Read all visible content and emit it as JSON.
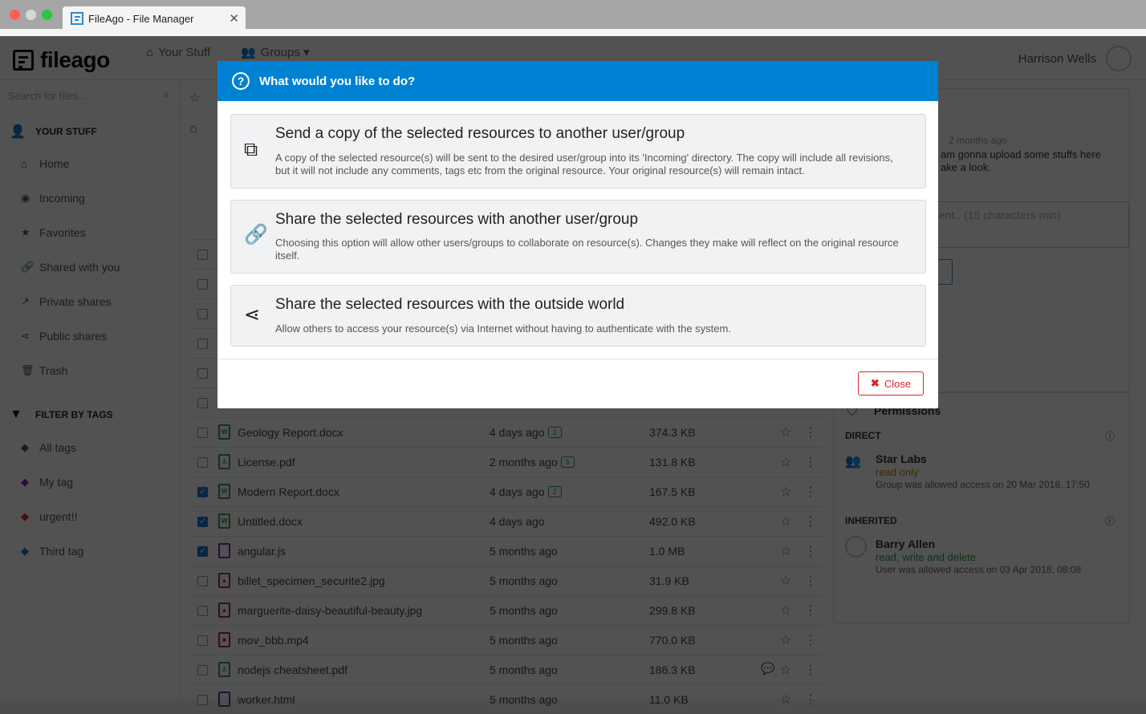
{
  "browser": {
    "tab_title": "FileAgo - File Manager"
  },
  "header": {
    "logo": "fileago",
    "nav_your_stuff": "Your Stuff",
    "nav_groups": "Groups",
    "user_name": "Harrison Wells"
  },
  "sidebar": {
    "search_placeholder": "Search for files...",
    "your_stuff": "YOUR STUFF",
    "items": [
      {
        "label": "Home",
        "icon": "home-icon"
      },
      {
        "label": "Incoming",
        "icon": "incoming-icon"
      },
      {
        "label": "Favorites",
        "icon": "star-icon"
      },
      {
        "label": "Shared with you",
        "icon": "link-icon"
      },
      {
        "label": "Private shares",
        "icon": "external-link-icon"
      },
      {
        "label": "Public shares",
        "icon": "share-icon"
      },
      {
        "label": "Trash",
        "icon": "trash-icon"
      }
    ],
    "filter_by_tags": "FILTER BY TAGS",
    "tags": [
      {
        "label": "All tags",
        "color": "#555555"
      },
      {
        "label": "My tag",
        "color": "#7b2fa8"
      },
      {
        "label": "urgent!!",
        "color": "#d9262c"
      },
      {
        "label": "Third tag",
        "color": "#1a73d6"
      }
    ]
  },
  "files": [
    {
      "name": "Geology Report.docx",
      "date": "4 days ago",
      "versions": "2",
      "size": "374.3 KB",
      "checked": false,
      "type": "word"
    },
    {
      "name": "License.pdf",
      "date": "2 months ago",
      "versions": "5",
      "size": "131.8 KB",
      "checked": false,
      "type": "pdf"
    },
    {
      "name": "Modern Report.docx",
      "date": "4 days ago",
      "versions": "2",
      "size": "167.5 KB",
      "checked": true,
      "type": "word"
    },
    {
      "name": "Untitled.docx",
      "date": "4 days ago",
      "size": "492.0 KB",
      "checked": true,
      "type": "word"
    },
    {
      "name": "angular.js",
      "date": "5 months ago",
      "size": "1.0 MB",
      "checked": true,
      "type": "code"
    },
    {
      "name": "billet_specimen_securite2.jpg",
      "date": "5 months ago",
      "size": "31.9 KB",
      "checked": false,
      "type": "image"
    },
    {
      "name": "marguerite-daisy-beautiful-beauty.jpg",
      "date": "5 months ago",
      "size": "299.8 KB",
      "checked": false,
      "type": "image"
    },
    {
      "name": "mov_bbb.mp4",
      "date": "5 months ago",
      "size": "770.0 KB",
      "checked": false,
      "type": "video"
    },
    {
      "name": "nodejs cheatsheet.pdf",
      "date": "5 months ago",
      "size": "186.3 KB",
      "checked": false,
      "type": "pdf",
      "has_comments": true
    },
    {
      "name": "worker.html",
      "date": "5 months ago",
      "size": "11.0 KB",
      "checked": false,
      "type": "code"
    }
  ],
  "comments": {
    "time": "2 months ago",
    "text_line1": "am gonna upload some stuffs here",
    "text_line2": "ake a look.",
    "placeholder": "ent.. (15 characters min)"
  },
  "permissions": {
    "title": "Permissions",
    "direct": "DIRECT",
    "inherited": "INHERITED",
    "direct_entry": {
      "name": "Star Labs",
      "access": "read only",
      "note": "Group was allowed access on 20 Mar 2018, 17:50",
      "access_color": "#b8860b"
    },
    "inherited_entry": {
      "name": "Barry Allen",
      "access": "read, write and delete",
      "note": "User was allowed access on 03 Apr 2018, 08:08",
      "access_color": "#1e9e3a"
    }
  },
  "modal": {
    "title": "What would you like to do?",
    "accent": "#0082d4",
    "options": [
      {
        "title": "Send a copy of the selected resources to another user/group",
        "description": "A copy of the selected resource(s) will be sent to the desired user/group into its 'Incoming' directory. The copy will include all revisions, but it will not include any comments, tags etc from the original resource. Your original resource(s) will remain intact.",
        "icon": "copy-icon"
      },
      {
        "title": "Share the selected resources with another user/group",
        "description": "Choosing this option will allow other users/groups to collaborate on resource(s). Changes they make will reflect on the original resource itself.",
        "icon": "link-icon"
      },
      {
        "title": "Share the selected resources with the outside world",
        "description": "Allow others to access your resource(s) via Internet without having to authenticate with the system.",
        "icon": "share-icon"
      }
    ],
    "close_label": "Close"
  }
}
